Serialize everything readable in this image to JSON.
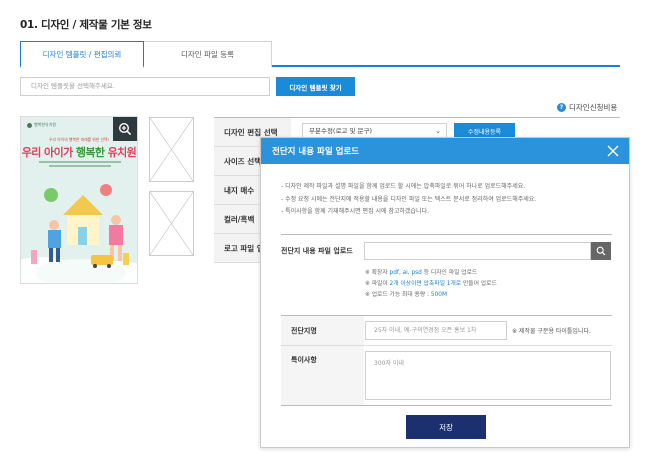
{
  "page": {
    "title": "01. 디자인 / 제작물 기본 정보"
  },
  "tabs": [
    {
      "label": "디자인 템플릿 / 편집의뢰",
      "active": true
    },
    {
      "label": "디자인 파일 등록",
      "active": false
    }
  ],
  "template_search": {
    "placeholder": "디자인 템플릿을 선택해주세요.",
    "button_label": "디자인 템플릿 찾기"
  },
  "help_link": {
    "icon": "question-icon",
    "label": "디자인신청비용"
  },
  "preview": {
    "logo_text": "행복한유치원",
    "subtitle": "우리 아이의 행복한 미래를 위한 선택!",
    "headline_red": "우리 아이가 ",
    "headline_green": "행복한",
    "headline_end": " 유치원"
  },
  "options": [
    {
      "label": "디자인 편집 선택",
      "select_value": "부분수정(로고 및 문구)",
      "button_label": "수정내용등록"
    },
    {
      "label": "사이즈 선택"
    },
    {
      "label": "내지 매수"
    },
    {
      "label": "컬러/흑백"
    },
    {
      "label": "로고 파일 업"
    }
  ],
  "modal": {
    "title": "전단지 내용 파일 업로드",
    "notes": [
      "- 디자인 제작 파일과 설명 파일을 함께 업로드 할 시에는 압축파일로 묶어 하나로 업로드해주세요.",
      "- 수정 요청 시에는 전단지에 적용할 내용을 디자인 파일 또는 텍스트 문서로 정리하여 업로드해주세요.",
      "- 특이사항을 함께 기재해주시면 편집 시에 참고하겠습니다."
    ],
    "upload_label": "전단지 내용 파일 업로드",
    "hints": {
      "h1_pre": "※ 확장자 ",
      "h1_blue": "pdf, ai, psd",
      "h1_post": " 등 디자인 파일 업로드",
      "h2_pre": "※ 파일이 ",
      "h2_blue": "2개 이상이면 압축파일 1개로",
      "h2_post": " 만들어 업로드",
      "h3_pre": "※ 업로드 가능 최대 용량 : ",
      "h3_blue": "500M"
    },
    "name_label": "전단지명",
    "name_placeholder": "25자 이내, 예-구의연경점 오픈 홍보 1차",
    "name_hint": "※ 제작물 구분용 타이틀입니다.",
    "notes_label": "특이사항",
    "notes_placeholder": "300자 이내",
    "save_label": "저장"
  },
  "colors": {
    "accent": "#1a8bd9",
    "modal_header": "#2a93dc",
    "save_button": "#1c2f6e"
  }
}
